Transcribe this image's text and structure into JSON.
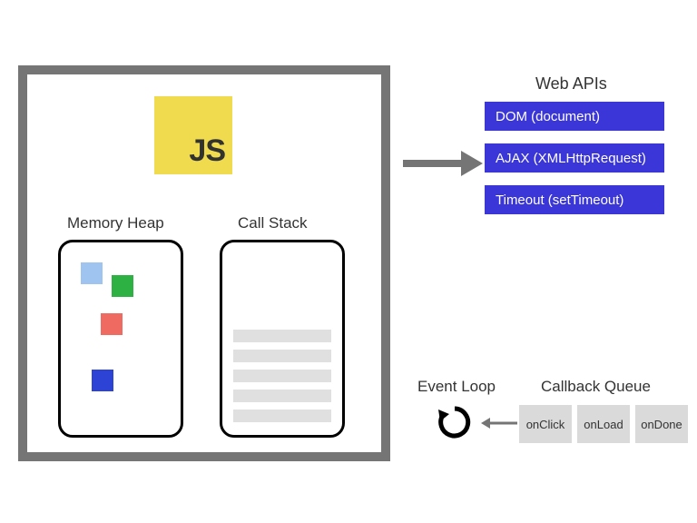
{
  "logo": {
    "text": "JS"
  },
  "engine": {
    "heap_label": "Memory Heap",
    "stack_label": "Call Stack"
  },
  "web_apis": {
    "title": "Web APIs",
    "items": [
      "DOM (document)",
      "AJAX (XMLHttpRequest)",
      "Timeout (setTimeout)"
    ]
  },
  "event_loop": {
    "label": "Event Loop"
  },
  "callback_queue": {
    "label": "Callback Queue",
    "items": [
      "onClick",
      "onLoad",
      "onDone"
    ]
  }
}
